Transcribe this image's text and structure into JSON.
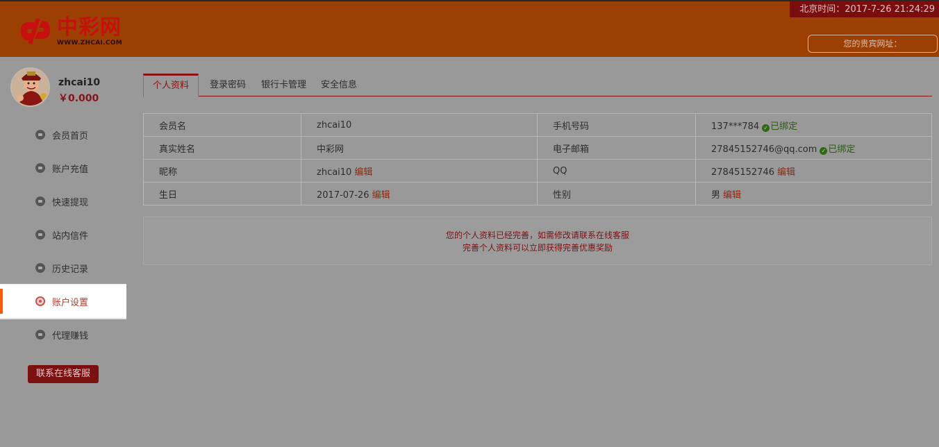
{
  "header": {
    "logo_name": "中彩网",
    "logo_url": "WWW.ZHCAI.COM",
    "clock_text": "北京时间：2017-7-26 21:24:29",
    "vip_label": "您的贵宾网址："
  },
  "user": {
    "name": "zhcai10",
    "balance": "￥0.000"
  },
  "sidebar": {
    "items": [
      {
        "label": "会员首页",
        "icon": "home-icon"
      },
      {
        "label": "账户充值",
        "icon": "wallet-icon"
      },
      {
        "label": "快速提现",
        "icon": "withdraw-icon"
      },
      {
        "label": "站内信件",
        "icon": "mail-icon"
      },
      {
        "label": "历史记录",
        "icon": "clock-icon"
      },
      {
        "label": "账户设置",
        "icon": "settings-icon",
        "active": true
      },
      {
        "label": "代理赚钱",
        "icon": "agent-icon"
      }
    ],
    "service_button": "联系在线客服"
  },
  "tabs": [
    {
      "label": "个人资料",
      "active": true
    },
    {
      "label": "登录密码"
    },
    {
      "label": "银行卡管理"
    },
    {
      "label": "安全信息"
    }
  ],
  "profile": {
    "rows": [
      {
        "l1": "会员名",
        "v1": "zhcai10",
        "l2": "手机号码",
        "v2": "137***784",
        "s2": "已绑定"
      },
      {
        "l1": "真实姓名",
        "v1": "中彩网",
        "l2": "电子邮箱",
        "v2": "27845152746@qq.com",
        "s2": "已绑定"
      },
      {
        "l1": "昵称",
        "v1": "zhcai10",
        "e1": "编辑",
        "l2": "QQ",
        "v2": "27845152746",
        "e2": "编辑"
      },
      {
        "l1": "生日",
        "v1": "2017-07-26",
        "e1": "编辑",
        "l2": "性别",
        "v2": "男",
        "e2": "编辑"
      }
    ]
  },
  "notice": {
    "line1": "您的个人资料已经完善，如需修改请联系在线客服",
    "line2": "完善个人资料可以立即获得完善优惠奖励"
  },
  "colors": {
    "header_bg": "#9b3f02",
    "accent": "#8b1212",
    "active_marker": "#ff5a00"
  }
}
